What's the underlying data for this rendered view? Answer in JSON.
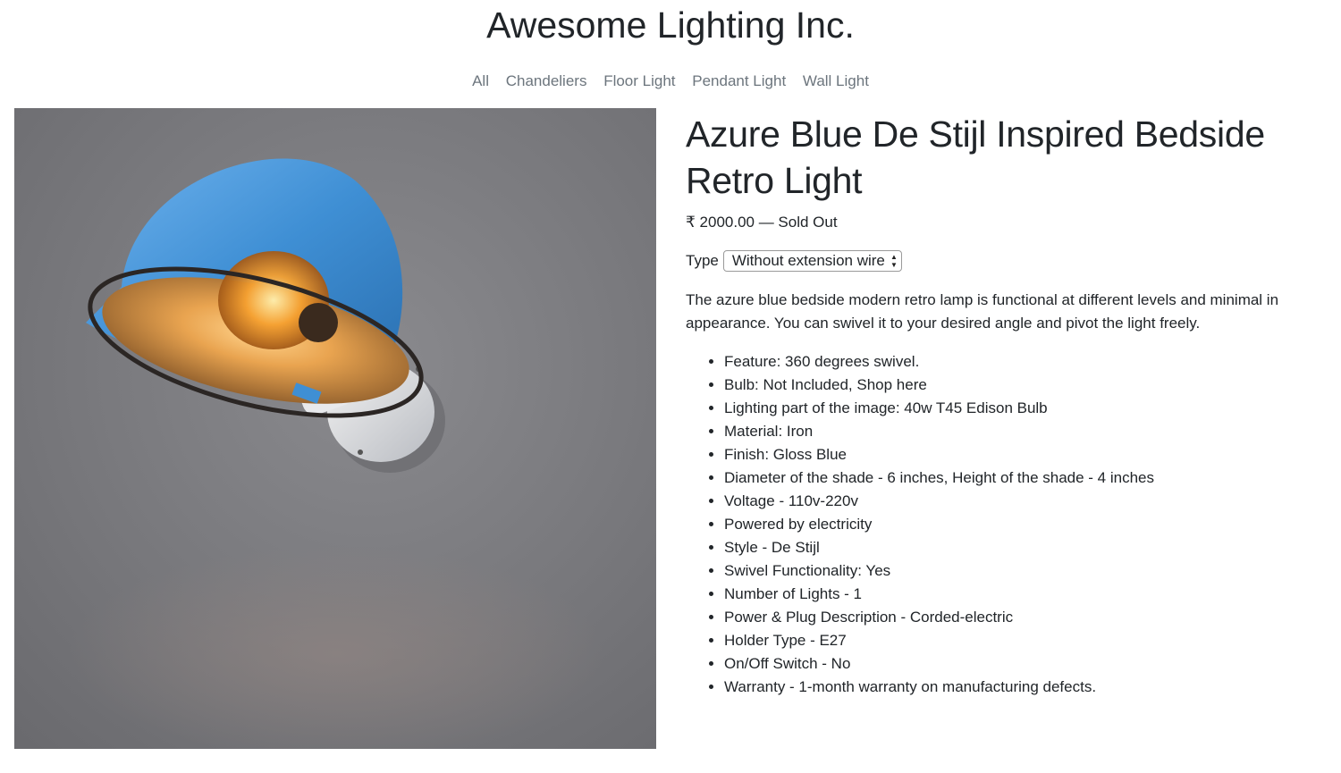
{
  "site": {
    "title": "Awesome Lighting Inc."
  },
  "nav": {
    "items": [
      {
        "label": "All"
      },
      {
        "label": "Chandeliers"
      },
      {
        "label": "Floor Light"
      },
      {
        "label": "Pendant Light"
      },
      {
        "label": "Wall Light"
      }
    ]
  },
  "product": {
    "title": "Azure Blue De Stijl Inspired Bedside Retro Light",
    "price": "₹ 2000.00 — Sold Out",
    "type_label": "Type",
    "type_selected": "Without extension wire",
    "description": "The azure blue bedside modern retro lamp is functional at different levels and minimal in appearance. You can swivel it to your desired angle and pivot the light freely.",
    "features": [
      "Feature: 360 degrees swivel.",
      "Bulb: Not Included, Shop here",
      "Lighting part of the image: 40w T45 Edison Bulb",
      "Material: Iron",
      "Finish: Gloss Blue",
      "Diameter of the shade - 6 inches, Height of the shade - 4 inches",
      "Voltage - 110v-220v",
      "Powered by electricity",
      "Style - De Stijl",
      "Swivel Functionality: Yes",
      "Number of Lights - 1",
      "Power & Plug Description - Corded-electric",
      "Holder Type - E27",
      "On/Off Switch - No",
      "Warranty - 1-month warranty on manufacturing defects."
    ]
  },
  "colors": {
    "lamp_shade": "#3f8fd4",
    "wall": "#7c7c80",
    "bulb_glow": "#f5a030"
  },
  "icons": {
    "select_arrows": "select-arrows-icon"
  }
}
